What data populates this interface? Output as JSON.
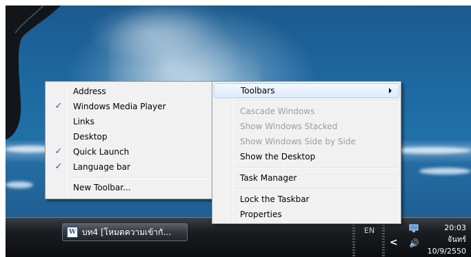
{
  "submenu": {
    "items": [
      {
        "label": "Address",
        "checked": false
      },
      {
        "label": "Windows Media Player",
        "checked": true
      },
      {
        "label": "Links",
        "checked": false
      },
      {
        "label": "Desktop",
        "checked": false
      },
      {
        "label": "Quick Launch",
        "checked": true
      },
      {
        "label": "Language bar",
        "checked": true
      }
    ],
    "new_toolbar": "New Toolbar...",
    "check_glyph": "✓"
  },
  "context_menu": {
    "toolbars": "Toolbars",
    "cascade": "Cascade Windows",
    "stacked": "Show Windows Stacked",
    "side_by_side": "Show Windows Side by Side",
    "show_desktop": "Show the Desktop",
    "task_manager": "Task Manager",
    "lock_taskbar": "Lock the Taskbar",
    "properties": "Properties"
  },
  "taskbar": {
    "window_button": "บท4 [โหมดความเข้ากั...",
    "word_icon_letter": "W",
    "language": "EN",
    "chevron": "<",
    "volume_icon": "🔊"
  },
  "clock": {
    "time": "20:03",
    "day": "จันทร์",
    "date": "10/9/2550"
  },
  "colors": {
    "menu_bg": "#f1f1f1",
    "highlight_border": "#aecff7",
    "check": "#2d58b8"
  }
}
